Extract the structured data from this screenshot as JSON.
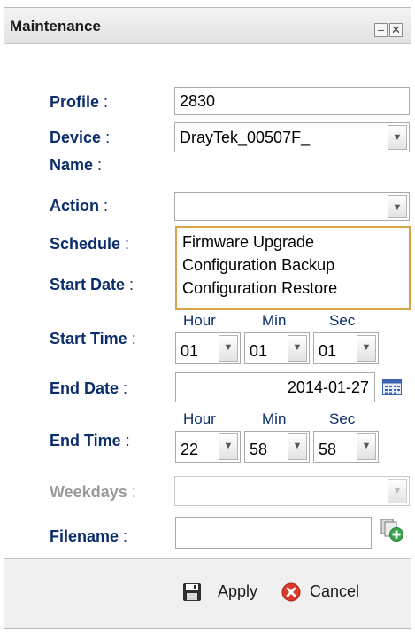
{
  "window": {
    "title": "Maintenance"
  },
  "form": {
    "profile": {
      "label": "Profile",
      "value": "2830"
    },
    "device": {
      "label": "Device",
      "label2": "Name",
      "value": "DrayTek_00507F_"
    },
    "action": {
      "label": "Action",
      "value": ""
    },
    "schedule": {
      "label": "Schedule"
    },
    "start_date": {
      "label": "Start Date"
    },
    "start_time": {
      "label": "Start Time",
      "hour_label": "Hour",
      "min_label": "Min",
      "sec_label": "Sec",
      "hour": "01",
      "min": "01",
      "sec": "01"
    },
    "end_date": {
      "label": "End Date",
      "value": "2014-01-27"
    },
    "end_time": {
      "label": "End Time",
      "hour_label": "Hour",
      "min_label": "Min",
      "sec_label": "Sec",
      "hour": "22",
      "min": "58",
      "sec": "58"
    },
    "weekdays": {
      "label": "Weekdays",
      "value": ""
    },
    "filename": {
      "label": "Filename",
      "value": ""
    }
  },
  "action_dropdown": {
    "options": [
      "Firmware Upgrade",
      "Configuration Backup",
      "Configuration Restore"
    ]
  },
  "footer": {
    "apply_label": "Apply",
    "cancel_label": "Cancel"
  },
  "icons": {
    "minimize": "minimize-icon",
    "close": "close-icon",
    "calendar": "calendar-icon",
    "file_add": "file-add-icon",
    "save": "save-icon",
    "cancel": "cancel-icon"
  },
  "colors": {
    "label": "#0b2d6b",
    "dropdown_border": "#d7a44a",
    "cancel_red": "#d93a2b",
    "add_green": "#3aa64a"
  }
}
